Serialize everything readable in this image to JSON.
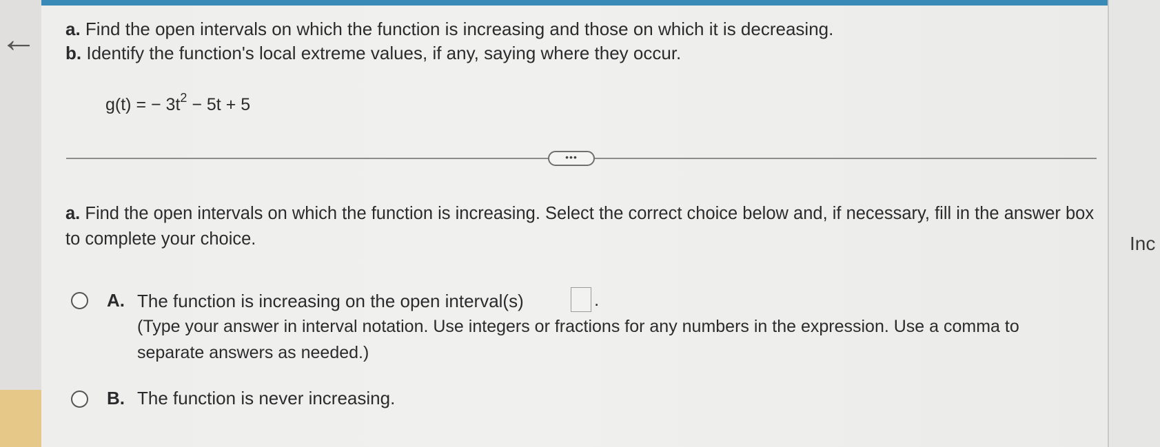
{
  "header": {
    "part_a_letter": "a.",
    "part_a_text": "Find the open intervals on which the function is increasing and those on which it is decreasing.",
    "part_b_letter": "b.",
    "part_b_text": "Identify the function's local extreme values, if any, saying where they occur."
  },
  "equation": {
    "lhs": "g(t) = − 3t",
    "exponent": "2",
    "rhs": " − 5t + 5"
  },
  "more_button": {
    "label": "•••"
  },
  "question": {
    "letter": "a.",
    "text": "Find the open intervals on which the function is increasing. Select the correct choice below and, if necessary, fill in the answer box to complete your choice."
  },
  "choices": [
    {
      "letter": "A.",
      "text": "The function is increasing on the open interval(s)",
      "suffix": ".",
      "hint": "(Type your answer in interval notation. Use integers or fractions for any numbers in the expression. Use a comma to separate answers as needed.)"
    },
    {
      "letter": "B.",
      "text": "The function is never increasing."
    }
  ],
  "right_panel": {
    "label": "Inc"
  },
  "icons": {
    "back": "back-arrow-icon"
  },
  "colors": {
    "top_bar": "#3a8ab8",
    "text": "#2b2b2d"
  }
}
